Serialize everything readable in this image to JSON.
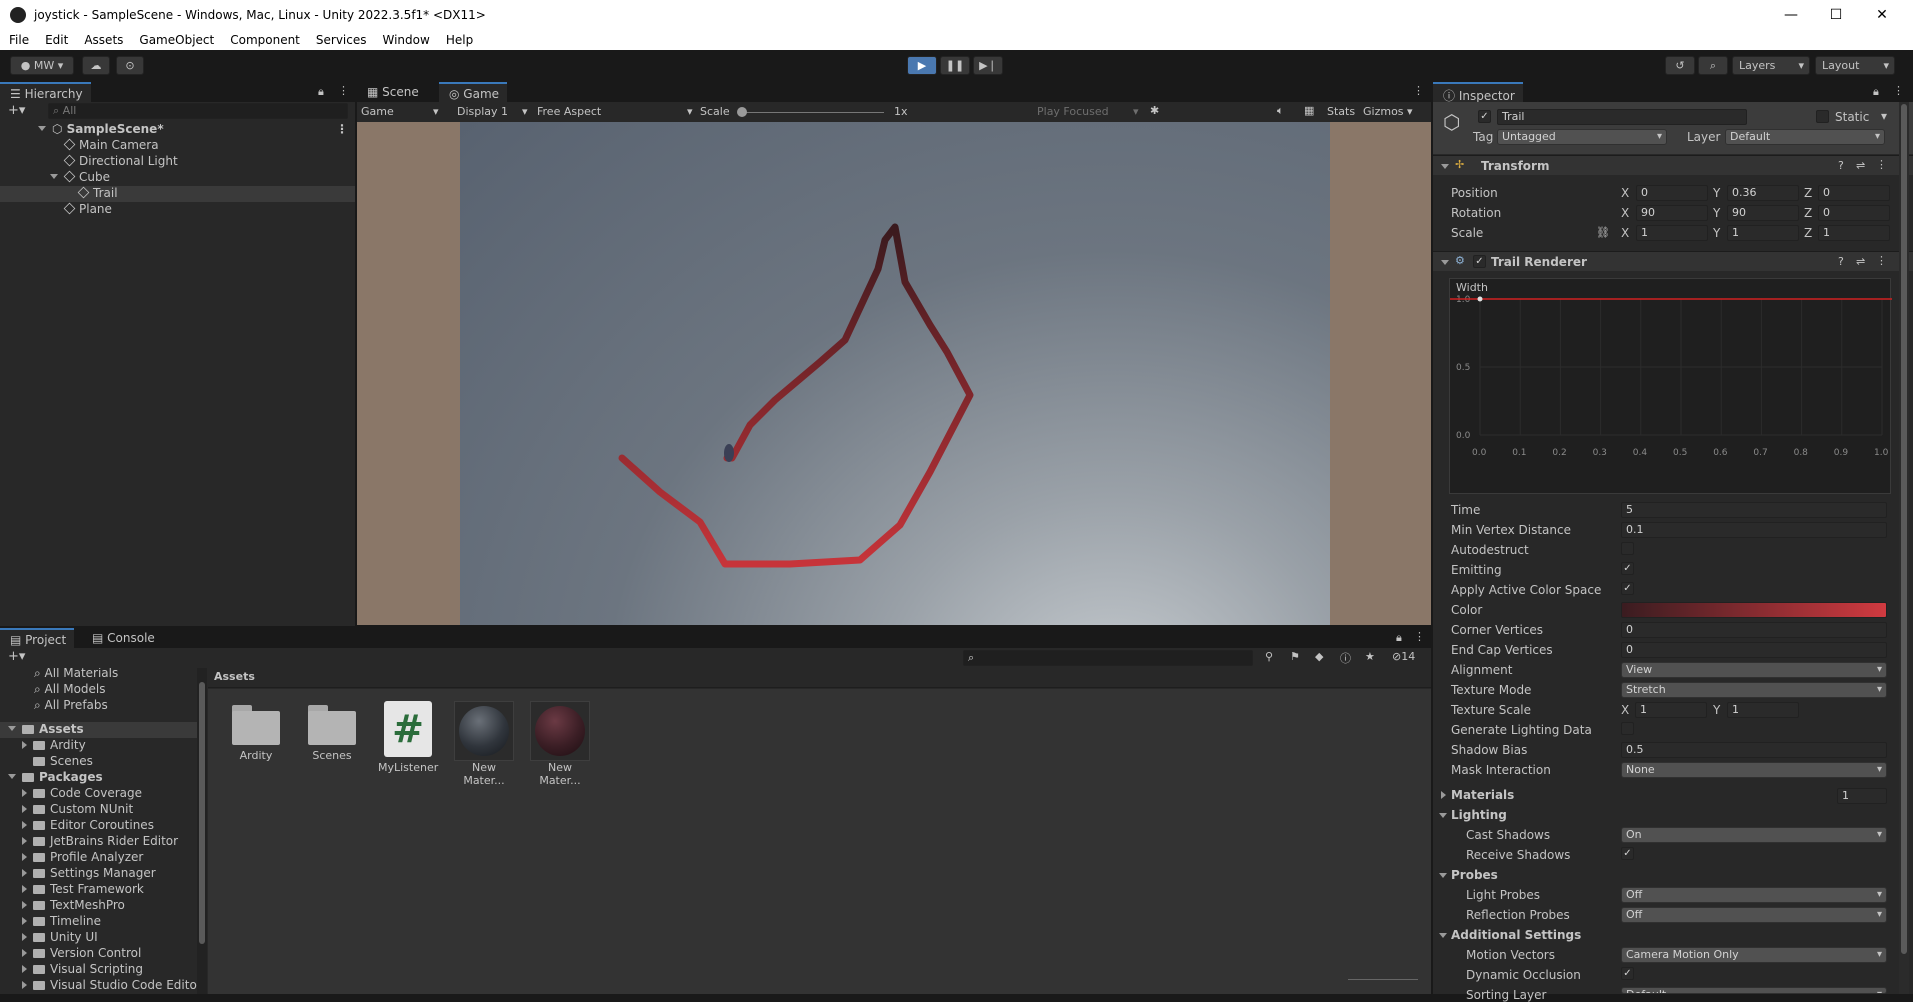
{
  "window": {
    "title": "joystick - SampleScene - Windows, Mac, Linux - Unity 2022.3.5f1* <DX11>"
  },
  "menu": [
    "File",
    "Edit",
    "Assets",
    "GameObject",
    "Component",
    "Services",
    "Window",
    "Help"
  ],
  "toolbar": {
    "account": "MW",
    "layers": "Layers",
    "layout": "Layout"
  },
  "hierarchy": {
    "tab": "Hierarchy",
    "search_placeholder": "All",
    "items": [
      {
        "label": "SampleScene*"
      },
      {
        "label": "Main Camera"
      },
      {
        "label": "Directional Light"
      },
      {
        "label": "Cube"
      },
      {
        "label": "Trail"
      },
      {
        "label": "Plane"
      }
    ]
  },
  "game_view": {
    "tabs": [
      "Scene",
      "Game"
    ],
    "mode": "Game",
    "display": "Display 1",
    "aspect": "Free Aspect",
    "scale_label": "Scale",
    "scale_value": "1x",
    "play_focused": "Play Focused",
    "stats": "Stats",
    "gizmos": "Gizmos"
  },
  "project": {
    "tabs": [
      "Project",
      "Console"
    ],
    "favorites": [
      "All Materials",
      "All Models",
      "All Prefabs"
    ],
    "tree": [
      {
        "label": "Assets",
        "bold": true
      },
      {
        "label": "Ardity"
      },
      {
        "label": "Scenes"
      },
      {
        "label": "Packages",
        "bold": true
      },
      {
        "label": "Code Coverage"
      },
      {
        "label": "Custom NUnit"
      },
      {
        "label": "Editor Coroutines"
      },
      {
        "label": "JetBrains Rider Editor"
      },
      {
        "label": "Profile Analyzer"
      },
      {
        "label": "Settings Manager"
      },
      {
        "label": "Test Framework"
      },
      {
        "label": "TextMeshPro"
      },
      {
        "label": "Timeline"
      },
      {
        "label": "Unity UI"
      },
      {
        "label": "Version Control"
      },
      {
        "label": "Visual Scripting"
      },
      {
        "label": "Visual Studio Code Editor"
      }
    ],
    "breadcrumb": "Assets",
    "hidden_count": "14",
    "assets": [
      {
        "label": "Ardity",
        "kind": "folder"
      },
      {
        "label": "Scenes",
        "kind": "folder"
      },
      {
        "label": "MyListener",
        "kind": "script"
      },
      {
        "label": "New Mater...",
        "kind": "material-dark"
      },
      {
        "label": "New Mater...",
        "kind": "material-maroon"
      }
    ]
  },
  "inspector": {
    "tab": "Inspector",
    "object_name": "Trail",
    "static_label": "Static",
    "tag_label": "Tag",
    "tag_value": "Untagged",
    "layer_label": "Layer",
    "layer_value": "Default",
    "transform": {
      "title": "Transform",
      "position": {
        "label": "Position",
        "x": "0",
        "y": "0.36",
        "z": "0"
      },
      "rotation": {
        "label": "Rotation",
        "x": "90",
        "y": "90",
        "z": "0"
      },
      "scale": {
        "label": "Scale",
        "x": "1",
        "y": "1",
        "z": "1"
      }
    },
    "trail_renderer": {
      "title": "Trail Renderer",
      "width_label": "Width",
      "curve_y_ticks": [
        "1.0",
        "0.5",
        "0.0"
      ],
      "curve_x_ticks": [
        "0.0",
        "0.1",
        "0.2",
        "0.3",
        "0.4",
        "0.5",
        "0.6",
        "0.7",
        "0.8",
        "0.9",
        "1.0"
      ],
      "width_value": 1.0,
      "props": [
        {
          "label": "Time",
          "value": "5",
          "type": "field"
        },
        {
          "label": "Min Vertex Distance",
          "value": "0.1",
          "type": "field"
        },
        {
          "label": "Autodestruct",
          "value": "",
          "type": "check"
        },
        {
          "label": "Emitting",
          "value": "✓",
          "type": "check"
        },
        {
          "label": "Apply Active Color Space",
          "value": "✓",
          "type": "check"
        },
        {
          "label": "Color",
          "value": "",
          "type": "color"
        },
        {
          "label": "Corner Vertices",
          "value": "0",
          "type": "field"
        },
        {
          "label": "End Cap Vertices",
          "value": "0",
          "type": "field"
        },
        {
          "label": "Alignment",
          "value": "View",
          "type": "dropdown"
        },
        {
          "label": "Texture Mode",
          "value": "Stretch",
          "type": "dropdown"
        },
        {
          "label": "Texture Scale",
          "value": "",
          "type": "xy",
          "x": "1",
          "y": "1"
        },
        {
          "label": "Generate Lighting Data",
          "value": "",
          "type": "check"
        },
        {
          "label": "Shadow Bias",
          "value": "0.5",
          "type": "field"
        },
        {
          "label": "Mask Interaction",
          "value": "None",
          "type": "dropdown"
        }
      ],
      "materials": {
        "label": "Materials",
        "count": "1"
      },
      "lighting": {
        "label": "Lighting",
        "cast_shadows": {
          "label": "Cast Shadows",
          "value": "On"
        },
        "receive_shadows": {
          "label": "Receive Shadows",
          "value": "✓"
        }
      },
      "probes": {
        "label": "Probes",
        "light_probes": {
          "label": "Light Probes",
          "value": "Off"
        },
        "reflection_probes": {
          "label": "Reflection Probes",
          "value": "Off"
        }
      },
      "additional": {
        "label": "Additional Settings",
        "motion_vectors": {
          "label": "Motion Vectors",
          "value": "Camera Motion Only"
        },
        "dynamic_occlusion": {
          "label": "Dynamic Occlusion",
          "value": "✓"
        },
        "sorting_layer": {
          "label": "Sorting Layer",
          "value": "Default"
        }
      }
    }
  }
}
